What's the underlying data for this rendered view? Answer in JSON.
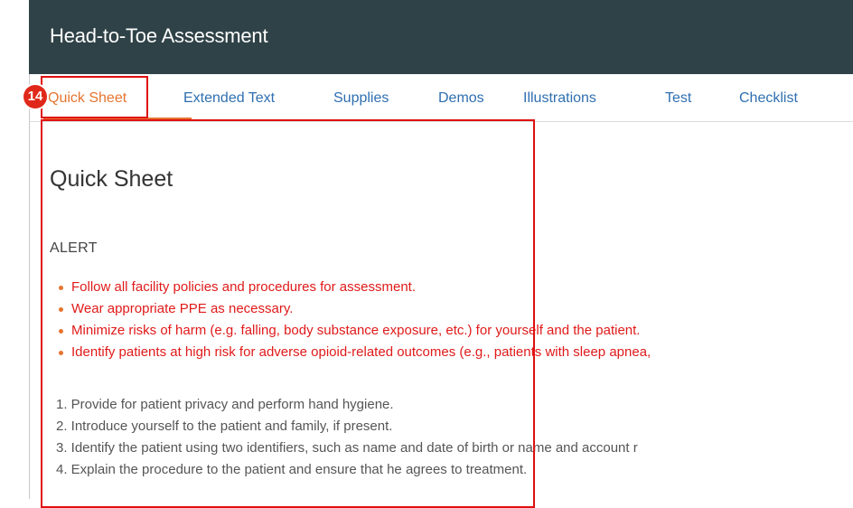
{
  "header": {
    "title": "Head-to-Toe Assessment"
  },
  "tabs": [
    {
      "label": "Quick Sheet",
      "active": true
    },
    {
      "label": "Extended Text"
    },
    {
      "label": "Supplies"
    },
    {
      "label": "Demos"
    },
    {
      "label": "Illustrations"
    },
    {
      "label": "Test"
    },
    {
      "label": "Checklist"
    }
  ],
  "main": {
    "heading": "Quick Sheet",
    "alert_label": "ALERT",
    "alerts": [
      "Follow all facility policies and procedures for assessment.",
      "Wear appropriate PPE as necessary.",
      "Minimize risks of harm (e.g. falling, body substance exposure, etc.) for yourself and the patient.",
      "Identify patients at high risk for adverse opioid-related outcomes (e.g., patients with sleep apnea,"
    ],
    "steps": [
      "1. Provide for patient privacy and perform hand hygiene.",
      "2. Introduce yourself to the patient and family, if present.",
      "3. Identify the patient using two identifiers, such as name and date of birth or name and account r",
      "4. Explain the procedure to the patient and ensure that he agrees to treatment."
    ]
  },
  "annotation": {
    "badge": "14"
  },
  "colors": {
    "titlebar": "#2f4247",
    "tab_link": "#2f6fb0",
    "tab_active": "#e5742f",
    "alert_text": "#e01a1a",
    "highlight": "#e01010"
  }
}
